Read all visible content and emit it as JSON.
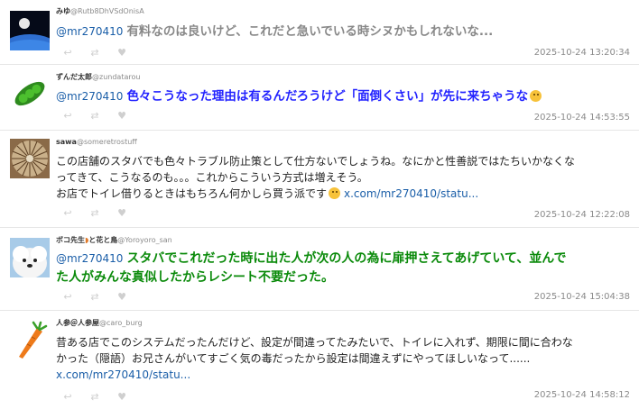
{
  "tweets": [
    {
      "display_name": "みゆ",
      "handle": "@Rutb8DhVSdOnisA",
      "mention": "@mr270410",
      "text": "有料なのは良いけど、これだと急いでいる時シヌかもしれないな...",
      "timestamp": "2025-10-24 13:20:34"
    },
    {
      "display_name": "ずんだ太郎",
      "handle": "@zundatarou",
      "mention": "@mr270410",
      "text": "色々こうなった理由は有るんだろうけど「面倒くさい」が先に来ちゃうな",
      "timestamp": "2025-10-24 14:53:55"
    },
    {
      "display_name": "sawa",
      "handle": "@someretrostuff",
      "lines": [
        "この店舗のスタバでも色々トラブル防止策として仕方ないでしょうね。なにかと性善説ではたちいかなくな",
        "ってきて、こうなるのも。。。これからこういう方式は増えそう。",
        "お店でトイレ借りるときはもちろん何かしら買う派です"
      ],
      "link": "x.com/mr270410/statu...",
      "timestamp": "2025-10-24 12:22:08"
    },
    {
      "display_name": "ボコ先生",
      "display_name_suffix": "と花と鳥",
      "handle": "@Yoroyoro_san",
      "mention": "@mr270410",
      "lines": [
        "スタバでこれだった時に出た人が次の人の為に扉押さえてあげていて、並んで",
        "た人がみんな真似したからレシート不要だった。"
      ],
      "timestamp": "2025-10-24 15:04:38"
    },
    {
      "display_name": "人参＠人参屋",
      "handle": "@caro_burg",
      "lines": [
        "昔ある店でこのシステムだったんだけど、設定が間違ってたみたいで、トイレに入れず、期限に間に合わな",
        "かった（隠語）お兄さんがいてすごく気の毒だったから設定は間違えずにやってほしいなって......"
      ],
      "link": "x.com/mr270410/statu...",
      "timestamp": "2025-10-24 14:58:12"
    }
  ],
  "colors": {
    "mention": "#1a5ea8",
    "grey_text": "#888888",
    "blue_text": "#2222ff",
    "green_text": "#0a8a0a",
    "timestamp": "#8a8a8a"
  }
}
